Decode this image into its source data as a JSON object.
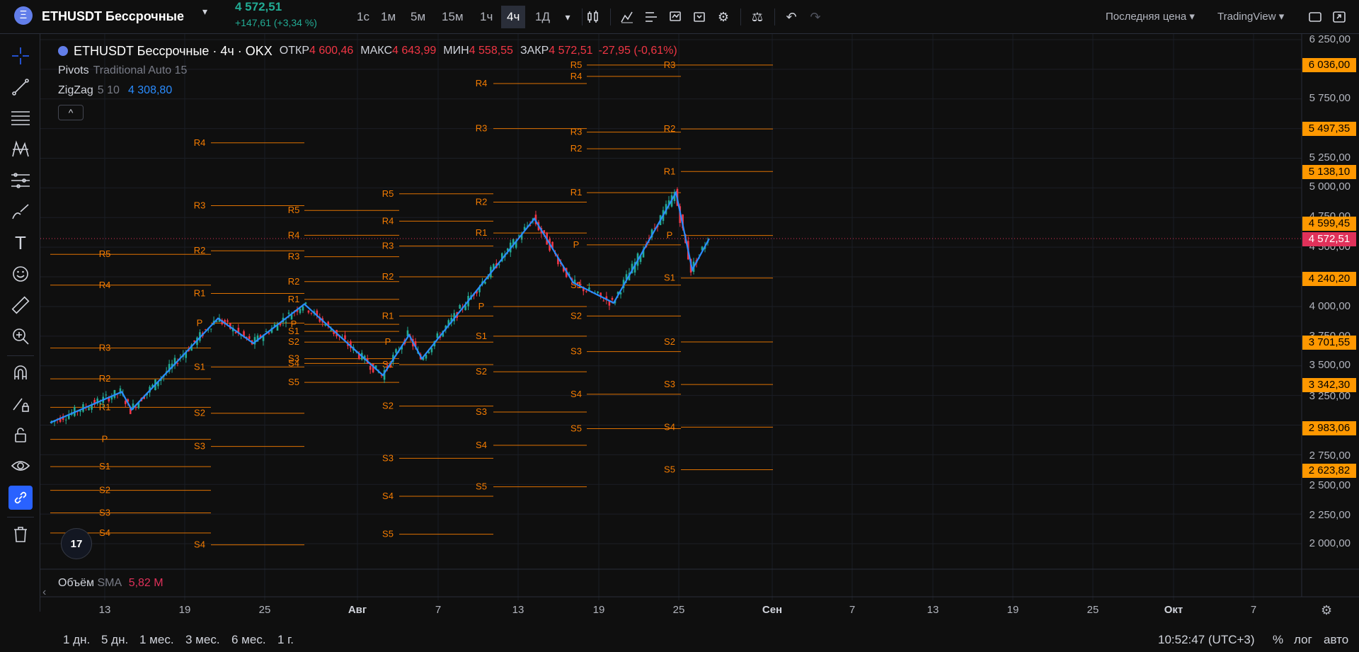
{
  "topbar": {
    "symbol_logo": "Ξ",
    "symbol_name": "ETHUSDT Бессрочные",
    "price": "4 572,51",
    "change": "+147,61 (+3,34 %)",
    "intervals": [
      "1с",
      "1м",
      "5м",
      "15м",
      "1ч",
      "4ч",
      "1Д"
    ],
    "active_interval": "4ч",
    "price_type": "Последняя цена",
    "provider": "TradingView",
    "icons": [
      "chevron-down-icon",
      "bar-style-icon",
      "indicators-icon",
      "templates-icon",
      "alert-icon",
      "replay-icon",
      "settings-icon",
      "balance-icon",
      "undo-icon",
      "redo-icon",
      "layout-icon",
      "fullscreen-icon"
    ]
  },
  "legend": {
    "title": "ETHUSDT Бессрочные · 4ч · OKX",
    "open_label": "ОТКР",
    "open": "4 600,46",
    "high_label": "МАКС",
    "high": "4 643,99",
    "low_label": "МИН",
    "low": "4 558,55",
    "close_label": "ЗАКР",
    "close": "4 572,51",
    "change": "-27,95 (-0,61%)",
    "pivots_name": "Pivots",
    "pivots_params": "Traditional Auto 15",
    "zigzag_name": "ZigZag",
    "zigzag_params": "5 10",
    "zigzag_value": "4 308,80",
    "collapse": "^"
  },
  "volume": {
    "name": "Объём",
    "ma": "SMA",
    "value": "5,82 M"
  },
  "price_axis": {
    "ticks": [
      "6 250,00",
      "5 750,00",
      "5 250,00",
      "5 000,00",
      "4 750,00",
      "4 500,00",
      "4 000,00",
      "3 750,00",
      "3 500,00",
      "3 250,00",
      "2 750,00",
      "2 500,00",
      "2 250,00",
      "2 000,00"
    ],
    "tags": [
      "6 036,00",
      "5 497,35",
      "5 138,10",
      "4 599,45",
      "4 240,20",
      "3 701,55",
      "3 342,30",
      "2 983,06",
      "2 623,82"
    ],
    "last_price_tag": "4 572,51"
  },
  "time_axis": [
    "13",
    "19",
    "25",
    "Авг",
    "7",
    "13",
    "19",
    "25",
    "Сен",
    "7",
    "13",
    "19",
    "25",
    "Окт",
    "7"
  ],
  "bottombar": {
    "ranges": [
      "1 дн.",
      "5 дн.",
      "1 мес.",
      "3 мес.",
      "6 мес.",
      "1 г."
    ],
    "clock": "10:52:47 (UTC+3)",
    "percent": "%",
    "log": "лог",
    "auto": "авто"
  },
  "left_tools": [
    "crosshair-icon",
    "trend-line-icon",
    "fib-icon",
    "pattern-icon",
    "forecast-icon",
    "brush-icon",
    "text-icon",
    "emoji-icon",
    "ruler-icon",
    "zoom-in-icon",
    "magnet-icon",
    "lock-drawing-icon",
    "lock-icon",
    "eye-icon",
    "link-icon",
    "trash-icon"
  ],
  "tv_logo": "17",
  "chart_data": {
    "type": "candlestick",
    "y_range": [
      1850,
      6350
    ],
    "pivot_labels": [
      "R5",
      "R4",
      "R3",
      "R2",
      "R1",
      "P",
      "S1",
      "S2",
      "S3",
      "S4",
      "S5"
    ],
    "pivot_periods": [
      {
        "levels": {
          "R5": 4440,
          "R4": 4180,
          "R3": 3650,
          "R2": 3390,
          "R1": 3150,
          "P": 2880,
          "S1": 2650,
          "S2": 2450,
          "S3": 2260,
          "S4": 2090
        }
      },
      {
        "levels": {
          "R4": 5380,
          "R3": 4850,
          "R2": 4470,
          "R1": 4110,
          "P": 3860,
          "S1": 3490,
          "S2": 3100,
          "S3": 2820,
          "S4": 1990
        }
      },
      {
        "levels": {
          "R5": 4810,
          "R4": 4600,
          "R3": 4420,
          "R2": 4210,
          "R1": 4060,
          "P": 3850,
          "S1": 3790,
          "S2": 3700,
          "S3": 3560,
          "S4": 3520,
          "S5": 3360
        }
      },
      {
        "levels": {
          "R5": 4950,
          "R4": 4720,
          "R3": 4510,
          "R2": 4250,
          "R1": 3920,
          "P": 3700,
          "S1": 3510,
          "S2": 3160,
          "S3": 2720,
          "S4": 2400,
          "S5": 2080
        }
      },
      {
        "levels": {
          "R4": 5880,
          "R3": 5500,
          "R2": 4880,
          "R1": 4620,
          "P": 4000,
          "S1": 3750,
          "S2": 3450,
          "S3": 3110,
          "S4": 2830,
          "S5": 2480
        }
      },
      {
        "levels": {
          "R5": 6036,
          "R4": 5940,
          "R3": 5470,
          "R2": 5330,
          "R1": 4960,
          "P": 4520,
          "S1": 4180,
          "S2": 3920,
          "S3": 3620,
          "S4": 3260,
          "S5": 2970
        }
      },
      {
        "levels": {
          "R3": 6036,
          "R2": 5497,
          "R1": 5138,
          "P": 4599,
          "S1": 4240,
          "S2": 3701,
          "S3": 3342,
          "S4": 2983,
          "S5": 2624
        }
      }
    ],
    "zigzag": [
      3020,
      3280,
      3130,
      3900,
      3690,
      4020,
      3420,
      3760,
      3560,
      4740,
      4200,
      4030,
      4960,
      4310,
      4572
    ],
    "last_price": 4572.51
  }
}
